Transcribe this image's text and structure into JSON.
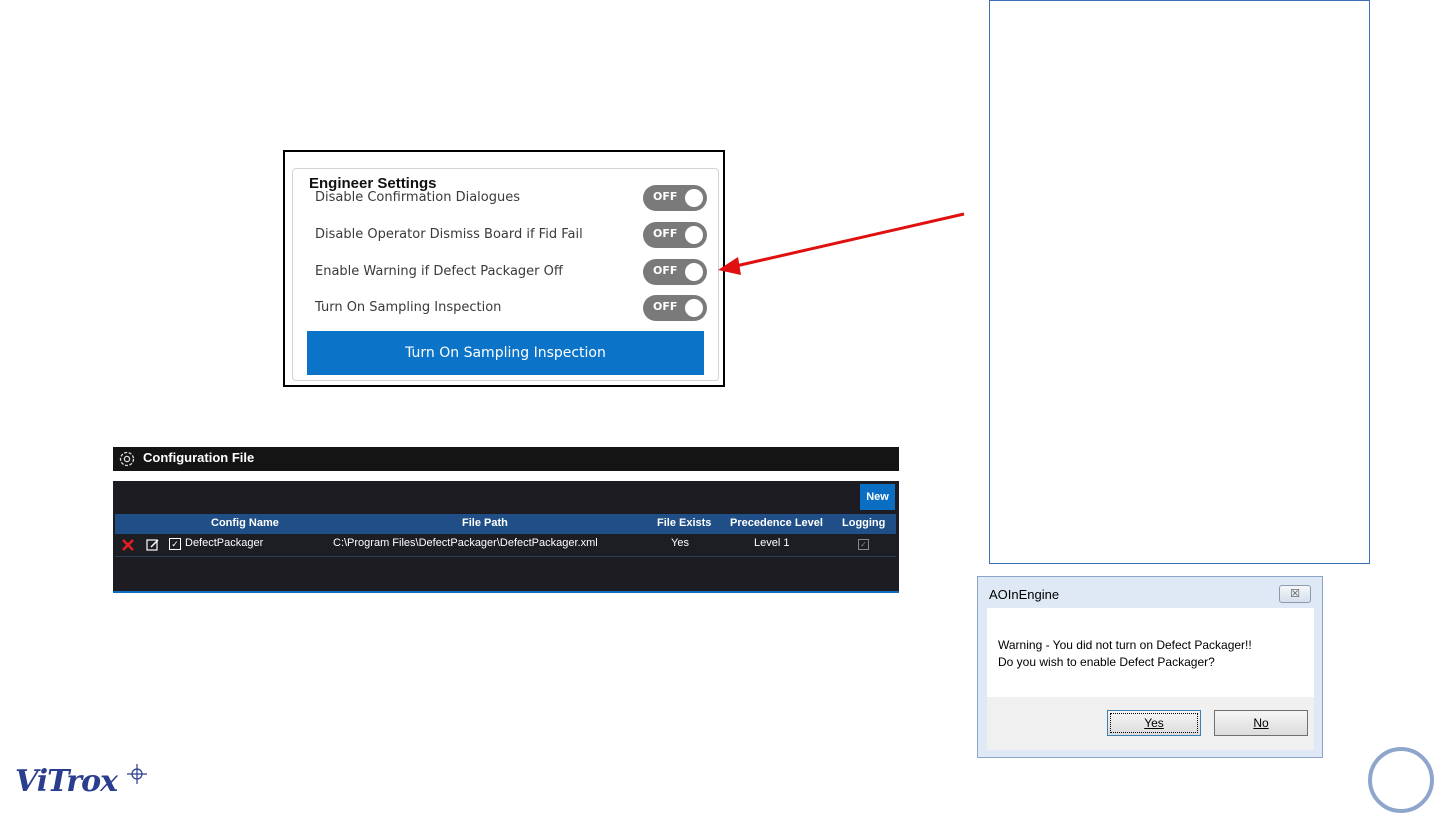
{
  "engineer_settings": {
    "title": "Engineer Settings",
    "rows": [
      {
        "label": "Disable Confirmation Dialogues",
        "toggle": "OFF"
      },
      {
        "label": "Disable Operator Dismiss Board if Fid Fail",
        "toggle": "OFF"
      },
      {
        "label": "Enable Warning if Defect Packager Off",
        "toggle": "OFF"
      },
      {
        "label": "Turn On Sampling Inspection",
        "toggle": "OFF"
      }
    ],
    "action_button": "Turn On Sampling Inspection",
    "accent_color": "#0b74c9"
  },
  "configuration_file": {
    "title": "Configuration File",
    "new_button": "New",
    "columns": [
      "Config Name",
      "File Path",
      "File Exists",
      "Precedence Level",
      "Logging"
    ],
    "rows": [
      {
        "config_name": "DefectPackager",
        "file_path": "C:\\Program Files\\DefectPackager\\DefectPackager.xml",
        "file_exists": "Yes",
        "precedence_level": "Level  1",
        "checked": "✓",
        "logging": "✓"
      }
    ]
  },
  "dialog": {
    "title": "AOInEngine",
    "close": "☒",
    "message_line1": "Warning - You did not turn on Defect Packager!!",
    "message_line2": "Do you wish to enable Defect Packager?",
    "yes": "Yes",
    "no": "No"
  },
  "logo": {
    "text": "ViTrox"
  },
  "icons": {
    "gear": "gear-icon",
    "delete": "close-x-icon",
    "edit": "edit-icon",
    "arrow": "arrow-icon"
  },
  "colors": {
    "arrow": "#e01010",
    "delete_x": "#e02020",
    "header_bg": "#1f4f86",
    "new_button": "#0a6fc2"
  }
}
